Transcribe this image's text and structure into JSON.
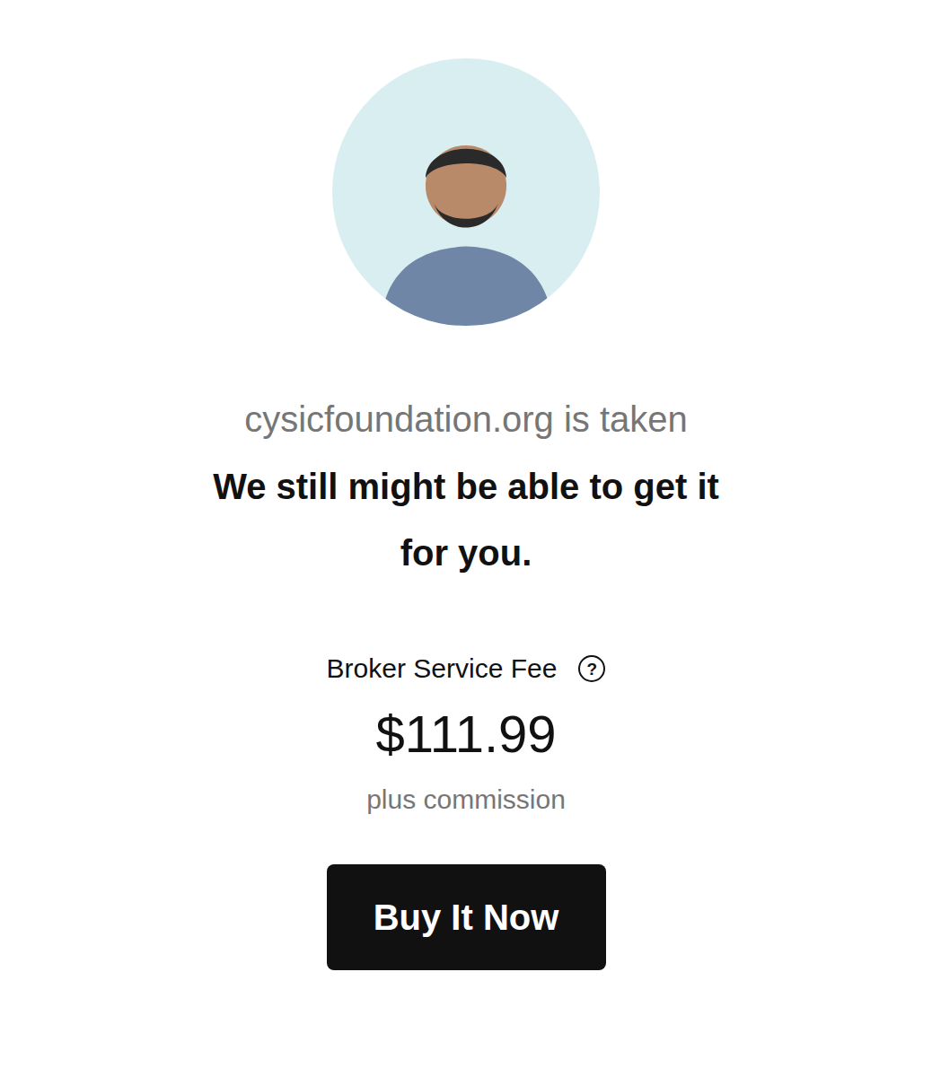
{
  "headline": "cysicfoundation.org is taken",
  "subheadline": "We still might be able to get it for you.",
  "fee": {
    "label": "Broker Service Fee",
    "help": "?",
    "amount": "$111.99",
    "note": "plus commission"
  },
  "button": {
    "label": "Buy It Now"
  }
}
